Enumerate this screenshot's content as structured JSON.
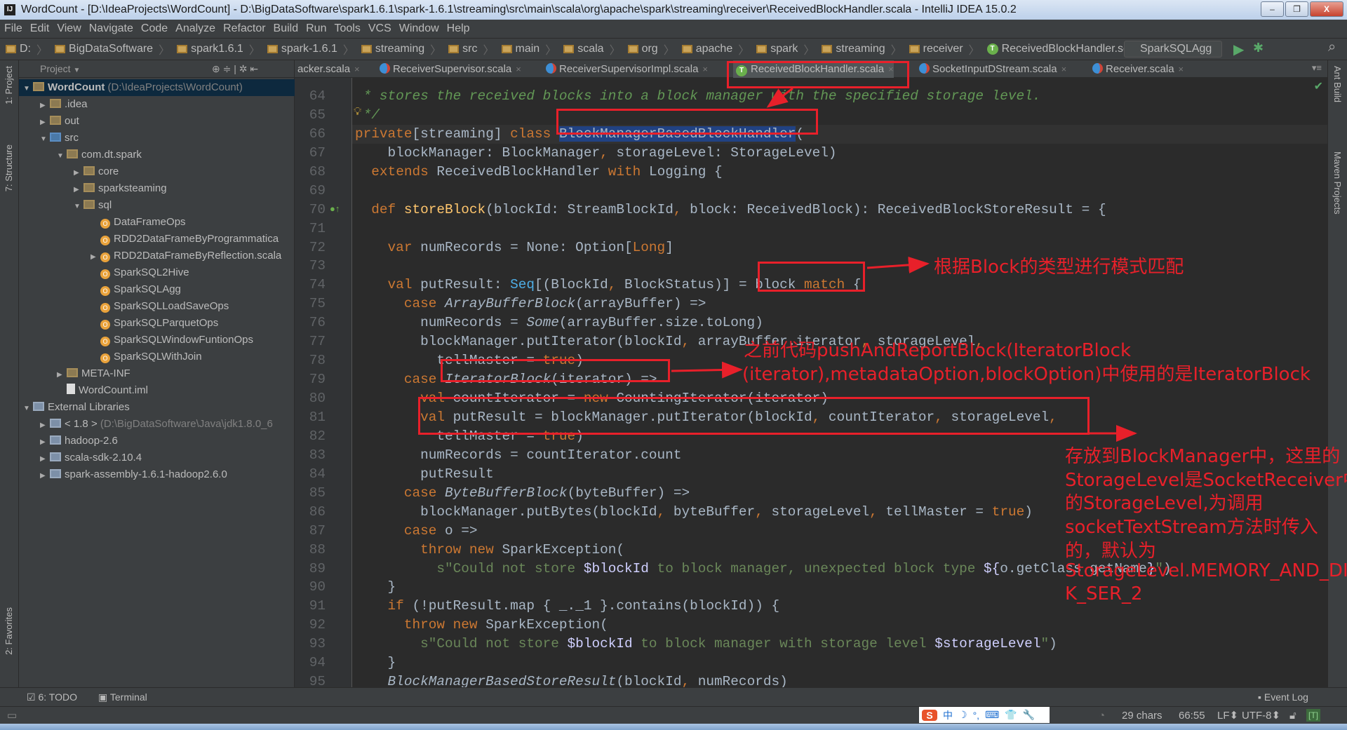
{
  "window": {
    "title": "WordCount - [D:\\IdeaProjects\\WordCount] - D:\\BigDataSoftware\\spark1.6.1\\spark-1.6.1\\streaming\\src\\main\\scala\\org\\apache\\spark\\streaming\\receiver\\ReceivedBlockHandler.scala - IntelliJ IDEA 15.0.2",
    "app_icon": "IJ",
    "minimize": "–",
    "restore": "❐",
    "close": "X"
  },
  "menu": [
    "File",
    "Edit",
    "View",
    "Navigate",
    "Code",
    "Analyze",
    "Refactor",
    "Build",
    "Run",
    "Tools",
    "VCS",
    "Window",
    "Help"
  ],
  "breadcrumb": [
    "D:",
    "BigDataSoftware",
    "spark1.6.1",
    "spark-1.6.1",
    "streaming",
    "src",
    "main",
    "scala",
    "org",
    "apache",
    "spark",
    "streaming",
    "receiver",
    "ReceivedBlockHandler.scala"
  ],
  "run_config": "SparkSQLAgg",
  "left_strip": [
    "1: Project",
    "7: Structure",
    "2: Favorites"
  ],
  "right_strip": [
    "Ant Build",
    "Maven Projects"
  ],
  "project": {
    "header": "Project",
    "tree": [
      {
        "label": "WordCount",
        "dim": " (D:\\IdeaProjects\\WordCount)",
        "depth": 0,
        "arrow": "down",
        "icon": "folder",
        "selected": true,
        "bold": true
      },
      {
        "label": ".idea",
        "depth": 1,
        "arrow": "right",
        "icon": "folder"
      },
      {
        "label": "out",
        "depth": 1,
        "arrow": "right",
        "icon": "folder"
      },
      {
        "label": "src",
        "depth": 1,
        "arrow": "down",
        "icon": "src"
      },
      {
        "label": "com.dt.spark",
        "depth": 2,
        "arrow": "down",
        "icon": "folder"
      },
      {
        "label": "core",
        "depth": 3,
        "arrow": "right",
        "icon": "folder"
      },
      {
        "label": "sparksteaming",
        "depth": 3,
        "arrow": "right",
        "icon": "folder"
      },
      {
        "label": "sql",
        "depth": 3,
        "arrow": "down",
        "icon": "folder"
      },
      {
        "label": "DataFrameOps",
        "depth": 4,
        "icon": "obj"
      },
      {
        "label": "RDD2DataFrameByProgrammatica",
        "depth": 4,
        "icon": "obj"
      },
      {
        "label": "RDD2DataFrameByReflection.scala",
        "depth": 4,
        "arrow": "right",
        "icon": "obj"
      },
      {
        "label": "SparkSQL2Hive",
        "depth": 4,
        "icon": "obj"
      },
      {
        "label": "SparkSQLAgg",
        "depth": 4,
        "icon": "obj"
      },
      {
        "label": "SparkSQLLoadSaveOps",
        "depth": 4,
        "icon": "obj"
      },
      {
        "label": "SparkSQLParquetOps",
        "depth": 4,
        "icon": "obj"
      },
      {
        "label": "SparkSQLWindowFuntionOps",
        "depth": 4,
        "icon": "obj"
      },
      {
        "label": "SparkSQLWithJoin",
        "depth": 4,
        "icon": "obj"
      },
      {
        "label": "META-INF",
        "depth": 2,
        "arrow": "right",
        "icon": "folder"
      },
      {
        "label": "WordCount.iml",
        "depth": 2,
        "icon": "file"
      },
      {
        "label": "External Libraries",
        "depth": 0,
        "arrow": "down",
        "icon": "lib"
      },
      {
        "label": "< 1.8 >",
        "dim": " (D:\\BigDataSoftware\\Java\\jdk1.8.0_6",
        "depth": 1,
        "arrow": "right",
        "icon": "lib"
      },
      {
        "label": "hadoop-2.6",
        "depth": 1,
        "arrow": "right",
        "icon": "lib"
      },
      {
        "label": "scala-sdk-2.10.4",
        "depth": 1,
        "arrow": "right",
        "icon": "lib"
      },
      {
        "label": "spark-assembly-1.6.1-hadoop2.6.0",
        "depth": 1,
        "arrow": "right",
        "icon": "lib"
      }
    ]
  },
  "tabs": [
    {
      "label": "acker.scala",
      "icon": "none"
    },
    {
      "label": "ReceiverSupervisor.scala",
      "icon": "class"
    },
    {
      "label": "ReceiverSupervisorImpl.scala",
      "icon": "class"
    },
    {
      "label": "ReceivedBlockHandler.scala",
      "icon": "trait",
      "active": true
    },
    {
      "label": "SocketInputDStream.scala",
      "icon": "class"
    },
    {
      "label": "Receiver.scala",
      "icon": "class"
    }
  ],
  "editor": {
    "first_line": 64,
    "current_line": 66,
    "lines": [
      [
        [
          " * stores the received blocks into a block manager with the specified storage level.",
          "doc"
        ]
      ],
      [
        [
          " */",
          "doc"
        ]
      ],
      [
        [
          "private",
          "kw"
        ],
        [
          "[streaming] ",
          ""
        ],
        [
          "class ",
          "kw"
        ],
        [
          "BlockManagerBasedBlockHandler",
          "sel"
        ],
        [
          "(",
          ""
        ]
      ],
      [
        [
          "    blockManager: BlockManager",
          ""
        ],
        [
          ", ",
          "kw"
        ],
        [
          "storageLevel: StorageLevel)",
          ""
        ]
      ],
      [
        [
          "  ",
          ""
        ],
        [
          "extends ",
          "kw"
        ],
        [
          "ReceivedBlockHandler ",
          ""
        ],
        [
          "with ",
          "kw"
        ],
        [
          "Logging {",
          ""
        ]
      ],
      [],
      [
        [
          "  ",
          ""
        ],
        [
          "def ",
          "kw"
        ],
        [
          "storeBlock",
          "fn"
        ],
        [
          "(blockId: StreamBlockId",
          ""
        ],
        [
          ", ",
          "kw"
        ],
        [
          "block: ReceivedBlock): ReceivedBlockStoreResult = {",
          ""
        ]
      ],
      [],
      [
        [
          "    ",
          ""
        ],
        [
          "var ",
          "kw"
        ],
        [
          "numRecords = None: Option[",
          ""
        ],
        [
          "Long",
          "kw"
        ],
        [
          "]",
          ""
        ]
      ],
      [],
      [
        [
          "    ",
          ""
        ],
        [
          "val ",
          "kw"
        ],
        [
          "putResult: ",
          ""
        ],
        [
          "Seq",
          "ty"
        ],
        [
          "[(BlockId",
          ""
        ],
        [
          ", ",
          "kw"
        ],
        [
          "BlockStatus)] = block ",
          ""
        ],
        [
          "match ",
          "kw"
        ],
        [
          "{",
          ""
        ]
      ],
      [
        [
          "      ",
          ""
        ],
        [
          "case ",
          "kw"
        ],
        [
          "ArrayBufferBlock",
          "it"
        ],
        [
          "(arrayBuffer) =>",
          ""
        ]
      ],
      [
        [
          "        numRecords = ",
          ""
        ],
        [
          "Some",
          "it"
        ],
        [
          "(arrayBuffer.size.toLong)",
          ""
        ]
      ],
      [
        [
          "        blockManager.putIterator(blockId",
          ""
        ],
        [
          ", ",
          "kw"
        ],
        [
          "arrayBuffer.iterator",
          ""
        ],
        [
          ", ",
          "kw"
        ],
        [
          "storageLevel",
          ""
        ],
        [
          ",",
          "kw"
        ]
      ],
      [
        [
          "          tellMaster = ",
          ""
        ],
        [
          "true",
          "kw"
        ],
        [
          ")",
          ""
        ]
      ],
      [
        [
          "      ",
          ""
        ],
        [
          "case ",
          "kw"
        ],
        [
          "IteratorBlock",
          "it"
        ],
        [
          "(iterator) =>",
          ""
        ]
      ],
      [
        [
          "        ",
          ""
        ],
        [
          "val ",
          "kw"
        ],
        [
          "countIterator = ",
          ""
        ],
        [
          "new ",
          "kw"
        ],
        [
          "CountingIterator(iterator)",
          ""
        ]
      ],
      [
        [
          "        ",
          ""
        ],
        [
          "val ",
          "kw"
        ],
        [
          "putResult = blockManager.putIterator(blockId",
          ""
        ],
        [
          ", ",
          "kw"
        ],
        [
          "countIterator",
          ""
        ],
        [
          ", ",
          "kw"
        ],
        [
          "storageLevel",
          ""
        ],
        [
          ",",
          "kw"
        ]
      ],
      [
        [
          "          tellMaster = ",
          ""
        ],
        [
          "true",
          "kw"
        ],
        [
          ")",
          ""
        ]
      ],
      [
        [
          "        numRecords = countIterator.count",
          ""
        ]
      ],
      [
        [
          "        putResult",
          ""
        ]
      ],
      [
        [
          "      ",
          ""
        ],
        [
          "case ",
          "kw"
        ],
        [
          "ByteBufferBlock",
          "it"
        ],
        [
          "(byteBuffer) =>",
          ""
        ]
      ],
      [
        [
          "        blockManager.putBytes(blockId",
          ""
        ],
        [
          ", ",
          "kw"
        ],
        [
          "byteBuffer",
          ""
        ],
        [
          ", ",
          "kw"
        ],
        [
          "storageLevel",
          ""
        ],
        [
          ", ",
          "kw"
        ],
        [
          "tellMaster = ",
          ""
        ],
        [
          "true",
          "kw"
        ],
        [
          ")",
          ""
        ]
      ],
      [
        [
          "      ",
          ""
        ],
        [
          "case ",
          "kw"
        ],
        [
          "o =>",
          ""
        ]
      ],
      [
        [
          "        ",
          ""
        ],
        [
          "throw new ",
          "kw"
        ],
        [
          "SparkException(",
          ""
        ]
      ],
      [
        [
          "          ",
          ""
        ],
        [
          "s\"Could not store ",
          "str"
        ],
        [
          "$blockId",
          "interp"
        ],
        [
          " to block manager, unexpected block type ",
          "str"
        ],
        [
          "${",
          "interp"
        ],
        [
          "o.getClass.getName",
          ""
        ],
        [
          "}",
          "interp"
        ],
        [
          "\"",
          "str"
        ],
        [
          ")",
          ""
        ]
      ],
      [
        [
          "    }",
          ""
        ]
      ],
      [
        [
          "    ",
          ""
        ],
        [
          "if ",
          "kw"
        ],
        [
          "(!putResult.map { _._1 }.contains(blockId)) {",
          ""
        ]
      ],
      [
        [
          "      ",
          ""
        ],
        [
          "throw new ",
          "kw"
        ],
        [
          "SparkException(",
          ""
        ]
      ],
      [
        [
          "        ",
          ""
        ],
        [
          "s\"Could not store ",
          "str"
        ],
        [
          "$blockId",
          "interp"
        ],
        [
          " to block manager with storage level ",
          "str"
        ],
        [
          "$storageLevel",
          "interp"
        ],
        [
          "\"",
          "str"
        ],
        [
          ")",
          ""
        ]
      ],
      [
        [
          "    }",
          ""
        ]
      ],
      [
        [
          "    ",
          ""
        ],
        [
          "BlockManagerBasedStoreResult",
          "it"
        ],
        [
          "(blockId",
          ""
        ],
        [
          ", ",
          "kw"
        ],
        [
          "numRecords)",
          ""
        ]
      ]
    ]
  },
  "annotations": {
    "color": "#e8202a",
    "block_match": "根据Block的类型进行模式匹配",
    "iterator_line1": "之前代码pushAndReportBlock(IteratorBlock",
    "iterator_line2": "(iterator),metadataOption,blockOption)中使用的是IteratorBlock",
    "storage": [
      "存放到BlockManager中，这里的",
      "StorageLevel是SocketReceiver中",
      "的StorageLevel,为调用",
      "socketTextStream方法时传入",
      "的，默认为",
      "StorageLevel.MEMORY_AND_DIS",
      "K_SER_2"
    ]
  },
  "bottom_tools": {
    "todo": "6: TODO",
    "terminal": "Terminal",
    "event_log": "Event Log"
  },
  "status": {
    "chars": "29 chars",
    "position": "66:55",
    "line_sep": "LF",
    "encoding": "UTF-8",
    "ime": [
      "中",
      "☽",
      "°,",
      "⌨",
      "👕",
      "🔧"
    ]
  }
}
